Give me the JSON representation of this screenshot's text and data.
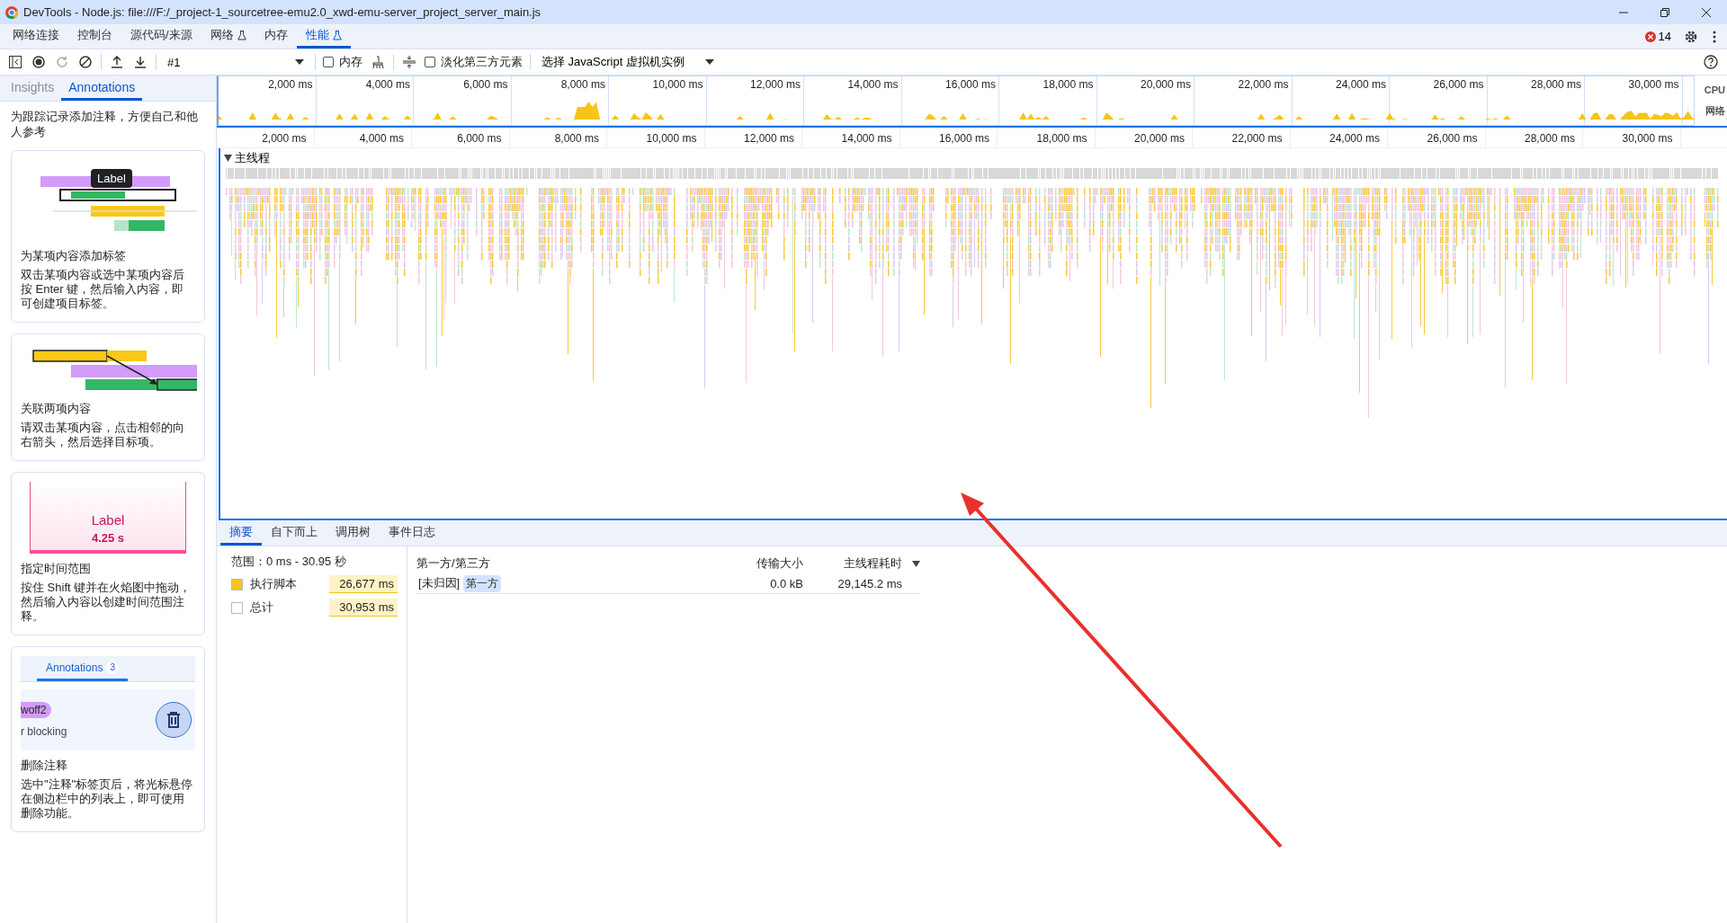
{
  "window": {
    "title": "DevTools - Node.js: file:///F:/_project-1_sourcetree-emu2.0_xwd-emu-server_project_server_main.js"
  },
  "panel_tabs": [
    {
      "label": "网络连接",
      "selected": false,
      "experimental": false
    },
    {
      "label": "控制台",
      "selected": false,
      "experimental": false
    },
    {
      "label": "源代码/来源",
      "selected": false,
      "experimental": false
    },
    {
      "label": "网络",
      "selected": false,
      "experimental": true
    },
    {
      "label": "内存",
      "selected": false,
      "experimental": false
    },
    {
      "label": "性能",
      "selected": true,
      "experimental": true
    }
  ],
  "error_count": "14",
  "toolbar": {
    "recording": "#1",
    "checkboxes": [
      {
        "label": "内存",
        "checked": false
      },
      {
        "label": "淡化第三方元素",
        "checked": false
      }
    ],
    "vm_select": "选择 JavaScript 虚拟机实例"
  },
  "sidebar": {
    "tabs": [
      {
        "label": "Insights",
        "selected": false
      },
      {
        "label": "Annotations",
        "selected": true
      }
    ],
    "intro": "为跟踪记录添加注释，方便自己和他人参考",
    "cards": [
      {
        "kind": "label",
        "demo_text": "Label",
        "title": "为某项内容添加标签",
        "body": "双击某项内容或选中某项内容后按 Enter 键，然后输入内容，即可创建项目标签。"
      },
      {
        "kind": "link",
        "title": "关联两项内容",
        "body": "请双击某项内容，点击相邻的向右箭头，然后选择目标项。"
      },
      {
        "kind": "range",
        "demo_text": "Label",
        "demo_time": "4.25 s",
        "title": "指定时间范围",
        "body": "按住 Shift 键并在火焰图中拖动，然后输入内容以创建时间范围注释。"
      },
      {
        "kind": "delete",
        "demo_tab": "Annotations",
        "demo_count": "3",
        "demo_chip": "woff2",
        "demo_line": "r blocking",
        "title": "删除注释",
        "body": "选中\"注释\"标签页后，将光标悬停在侧边栏中的列表上，即可使用删除功能。"
      }
    ]
  },
  "overview": {
    "ticks": [
      "2,000 ms",
      "4,000 ms",
      "6,000 ms",
      "8,000 ms",
      "10,000 ms",
      "12,000 ms",
      "14,000 ms",
      "16,000 ms",
      "18,000 ms",
      "20,000 ms",
      "22,000 ms",
      "24,000 ms",
      "26,000 ms",
      "28,000 ms",
      "30,000 ms"
    ],
    "tracks": [
      "CPU",
      "网络"
    ]
  },
  "ruler": {
    "ticks": [
      "2,000 ms",
      "4,000 ms",
      "6,000 ms",
      "8,000 ms",
      "10,000 ms",
      "12,000 ms",
      "14,000 ms",
      "16,000 ms",
      "18,000 ms",
      "20,000 ms",
      "22,000 ms",
      "24,000 ms",
      "26,000 ms",
      "28,000 ms",
      "30,000 ms"
    ]
  },
  "track": {
    "label": "主线程",
    "expanded": true
  },
  "details": {
    "tabs": [
      {
        "label": "摘要",
        "selected": true
      },
      {
        "label": "自下而上",
        "selected": false
      },
      {
        "label": "调用树",
        "selected": false
      },
      {
        "label": "事件日志",
        "selected": false
      }
    ],
    "range": "范围：0 ms - 30.95 秒",
    "legend": [
      {
        "label": "执行脚本",
        "value": "26,677 ms",
        "color": "#f5c518"
      },
      {
        "label": "总计",
        "value": "30,953 ms",
        "color": "#ffffff"
      }
    ],
    "table": {
      "columns": [
        "第一方/第三方",
        "传输大小",
        "主线程耗时"
      ],
      "rows": [
        {
          "entity": "[未归因]",
          "badge": "第一方",
          "size": "0.0 kB",
          "time": "29,145.2 ms"
        }
      ]
    }
  }
}
